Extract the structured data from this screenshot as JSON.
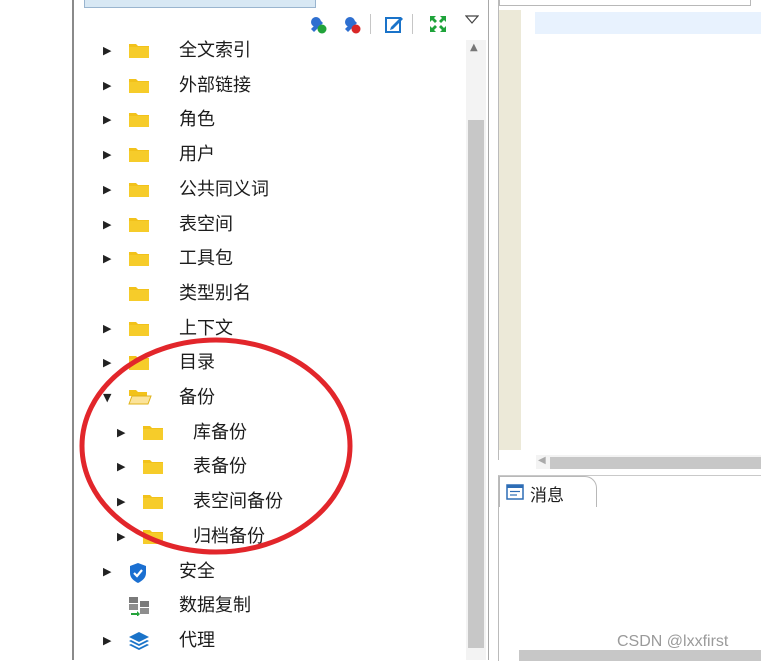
{
  "tree_panel": {
    "tab_label": "",
    "toolbar": [
      {
        "icon": "connect-icon"
      },
      {
        "icon": "disconnect-icon"
      },
      {
        "icon": "edit-icon"
      },
      {
        "icon": "expand-icon"
      },
      {
        "icon": "view-menu-icon"
      }
    ],
    "items": [
      {
        "label": "全文索引",
        "icon": "folder-icon",
        "expandable": true
      },
      {
        "label": "外部链接",
        "icon": "folder-icon",
        "expandable": true
      },
      {
        "label": "角色",
        "icon": "folder-icon",
        "expandable": true
      },
      {
        "label": "用户",
        "icon": "folder-icon",
        "expandable": true
      },
      {
        "label": "公共同义词",
        "icon": "folder-icon",
        "expandable": true
      },
      {
        "label": "表空间",
        "icon": "folder-icon",
        "expandable": true
      },
      {
        "label": "工具包",
        "icon": "folder-icon",
        "expandable": true
      },
      {
        "label": "类型别名",
        "icon": "folder-icon",
        "expandable": false
      },
      {
        "label": "上下文",
        "icon": "folder-icon",
        "expandable": true
      },
      {
        "label": "目录",
        "icon": "folder-icon",
        "expandable": true
      },
      {
        "label": "备份",
        "icon": "folder-open-icon",
        "expandable": true,
        "expanded": true
      },
      {
        "label": "库备份",
        "icon": "folder-icon",
        "expandable": true,
        "level": 2
      },
      {
        "label": "表备份",
        "icon": "folder-icon",
        "expandable": true,
        "level": 2
      },
      {
        "label": "表空间备份",
        "icon": "folder-icon",
        "expandable": true,
        "level": 2
      },
      {
        "label": "归档备份",
        "icon": "folder-icon",
        "expandable": true,
        "level": 2
      },
      {
        "label": "安全",
        "icon": "shield-icon",
        "expandable": true
      },
      {
        "label": "数据复制",
        "icon": "replication-icon",
        "expandable": false
      },
      {
        "label": "代理",
        "icon": "layers-icon",
        "expandable": true
      }
    ]
  },
  "editor": {
    "tab_label": ""
  },
  "messages": {
    "tab_label": "消息",
    "icon": "message-icon"
  },
  "watermark": "CSDN @lxxfirst",
  "colors": {
    "folder": "#f2c21b",
    "shield": "#1a6fd1",
    "annotation": "#e2262b"
  }
}
